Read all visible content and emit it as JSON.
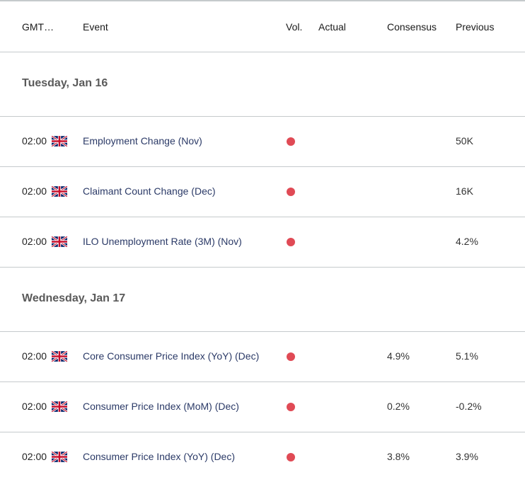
{
  "header": {
    "gmt": "GMT…",
    "event": "Event",
    "vol": "Vol.",
    "actual": "Actual",
    "consensus": "Consensus",
    "previous": "Previous"
  },
  "colors": {
    "vol_high": "#e04a55"
  },
  "days": [
    {
      "label": "Tuesday, Jan 16",
      "events": [
        {
          "time": "02:00",
          "country": "uk-flag",
          "name": "Employment Change (Nov)",
          "volatility": "high",
          "actual": "",
          "consensus": "",
          "previous": "50K"
        },
        {
          "time": "02:00",
          "country": "uk-flag",
          "name": "Claimant Count Change (Dec)",
          "volatility": "high",
          "actual": "",
          "consensus": "",
          "previous": "16K"
        },
        {
          "time": "02:00",
          "country": "uk-flag",
          "name": "ILO Unemployment Rate (3M) (Nov)",
          "volatility": "high",
          "actual": "",
          "consensus": "",
          "previous": "4.2%"
        }
      ]
    },
    {
      "label": "Wednesday, Jan 17",
      "events": [
        {
          "time": "02:00",
          "country": "uk-flag",
          "name": "Core Consumer Price Index (YoY) (Dec)",
          "volatility": "high",
          "actual": "",
          "consensus": "4.9%",
          "previous": "5.1%"
        },
        {
          "time": "02:00",
          "country": "uk-flag",
          "name": "Consumer Price Index (MoM) (Dec)",
          "volatility": "high",
          "actual": "",
          "consensus": "0.2%",
          "previous": "-0.2%"
        },
        {
          "time": "02:00",
          "country": "uk-flag",
          "name": "Consumer Price Index (YoY) (Dec)",
          "volatility": "high",
          "actual": "",
          "consensus": "3.8%",
          "previous": "3.9%"
        }
      ]
    }
  ]
}
